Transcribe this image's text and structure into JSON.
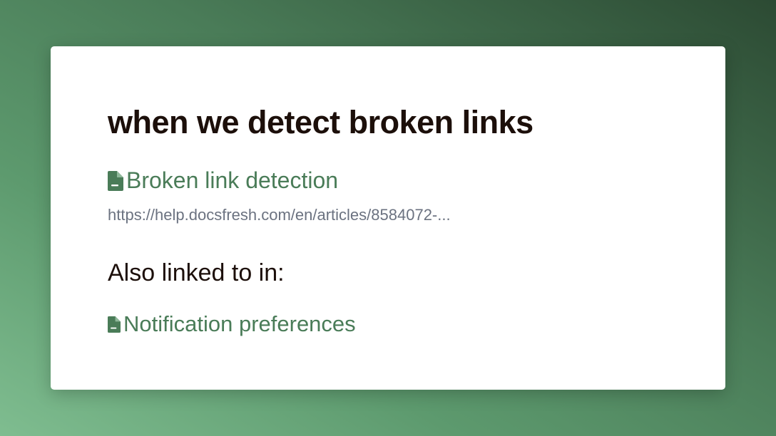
{
  "card": {
    "title": "when we detect broken links",
    "primary_link": {
      "label": "Broken link detection",
      "icon": "document-icon"
    },
    "url": "https://help.docsfresh.com/en/articles/8584072-...",
    "also_linked_heading": "Also linked to in:",
    "also_linked": [
      {
        "label": "Notification preferences",
        "icon": "document-icon"
      }
    ]
  },
  "colors": {
    "link": "#4a7c58",
    "title": "#1c0f0a",
    "url": "#6b7280",
    "card_bg": "#ffffff"
  }
}
